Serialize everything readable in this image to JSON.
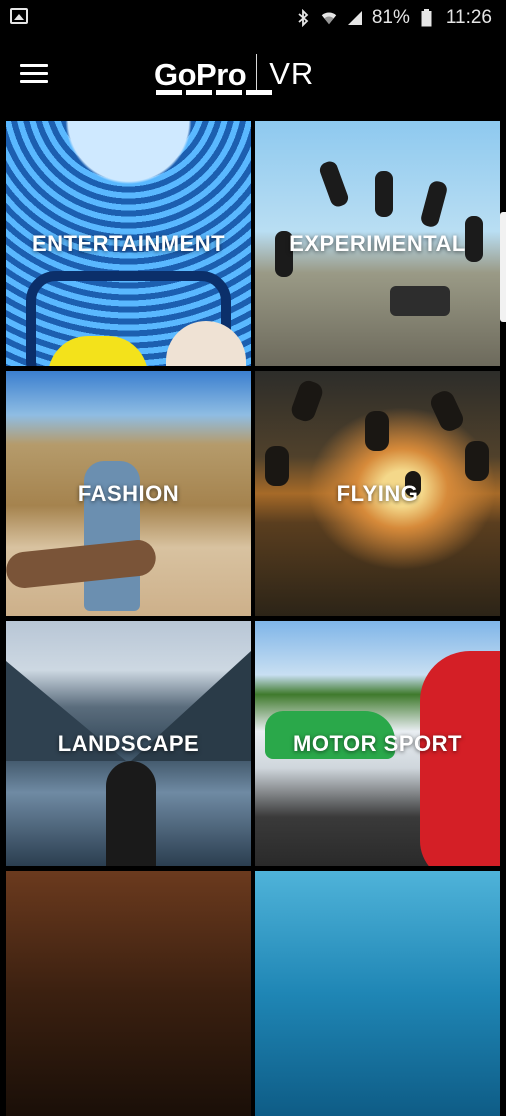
{
  "status_bar": {
    "battery": "81%",
    "time": "11:26",
    "icons": [
      "gallery-icon",
      "bluetooth-icon",
      "wifi-icon",
      "signal-icon",
      "battery-icon"
    ]
  },
  "header": {
    "logo_brand": "GoPro",
    "logo_suffix": "VR",
    "menu_icon": "hamburger-icon"
  },
  "categories": [
    {
      "label": "ENTERTAINMENT"
    },
    {
      "label": "EXPERIMENTAL"
    },
    {
      "label": "FASHION"
    },
    {
      "label": "FLYING"
    },
    {
      "label": "LANDSCAPE"
    },
    {
      "label": "MOTOR SPORT"
    },
    {
      "label": ""
    },
    {
      "label": ""
    }
  ],
  "colors": {
    "background": "#000000",
    "text": "#ffffff"
  }
}
